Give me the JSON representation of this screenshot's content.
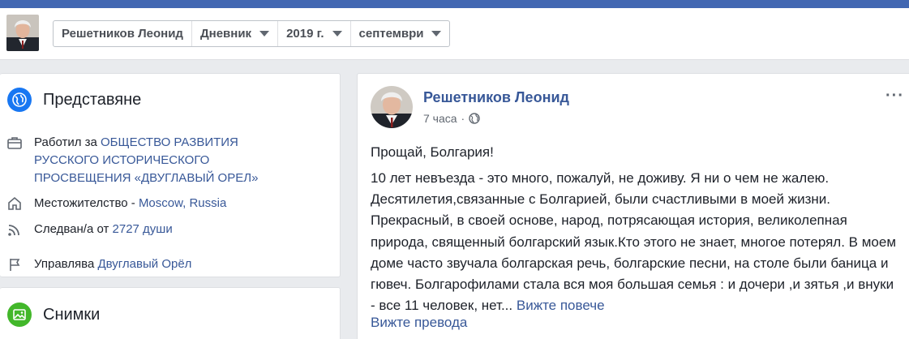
{
  "header": {
    "crumbs": [
      "Решетников Леонид",
      "Дневник",
      "2019 г.",
      "септември"
    ]
  },
  "intro": {
    "title": "Представяне",
    "work": {
      "prefix": "Работил за ",
      "link_line1": "ОБЩЕСТВО РАЗВИТИЯ",
      "link_line2": "РУССКОГО ИСТОРИЧЕСКОГО",
      "link_line3": "ПРОСВЕЩЕНИЯ «ДВУГЛАВЫЙ ОРЕЛ»"
    },
    "residence": {
      "prefix": "Местожителство - ",
      "link": "Moscow, Russia"
    },
    "followers": {
      "prefix": "Следван/а от ",
      "link": "2727 души"
    },
    "manages": {
      "prefix": "Управлява ",
      "link": "Двуглавый Орёл"
    }
  },
  "photos": {
    "title": "Снимки"
  },
  "post": {
    "author": "Решетников Леонид",
    "time": "7 часа",
    "separator": "·",
    "more_icon": "···",
    "title": "Прощай, Болгария!",
    "body": "10 лет невъезда - это много, пожалуй, не доживу. Я ни о чем не жалею. Десятилетия,связанные с Болгарией, были счастливыми в моей жизни. Прекрасный, в своей основе, народ, потрясающая история, великолепная природа, священный болгарский язык.Кто этого не знает, многое потерял. В моем доме часто звучала болгарская речь, болгарские песни, на столе были баница и гювеч. Болгарофилами стала вся моя большая семья : и дочери ,и зятья ,и внуки - все 11 человек, нет...",
    "see_more": "Вижте повече",
    "see_translation": "Вижте превода"
  },
  "icons": [
    "globe-icon",
    "briefcase-icon",
    "home-icon",
    "rss-icon",
    "flag-icon",
    "photo-icon",
    "public-globe-icon",
    "more-options-icon",
    "caret-down-icon"
  ],
  "colors": {
    "brand": "#4267b2",
    "link": "#385898",
    "background": "#e9ebee"
  }
}
